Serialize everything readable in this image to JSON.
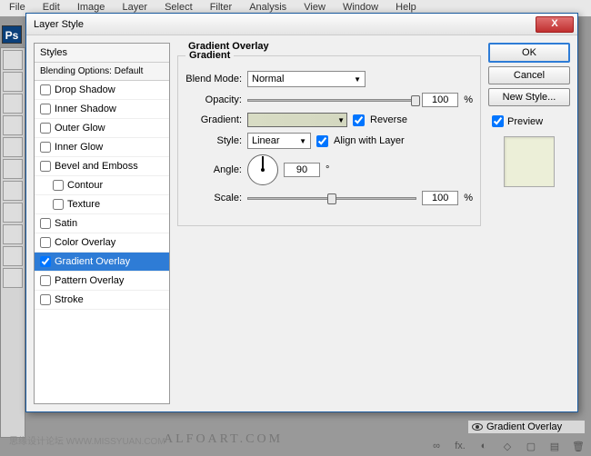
{
  "menubar": [
    "File",
    "Edit",
    "Image",
    "Layer",
    "Select",
    "Filter",
    "Analysis",
    "View",
    "Window",
    "Help"
  ],
  "dialog": {
    "title": "Layer Style",
    "close": "X"
  },
  "styles": {
    "header": "Styles",
    "blending": "Blending Options: Default",
    "items": [
      {
        "label": "Drop Shadow",
        "checked": false,
        "indent": false,
        "selected": false
      },
      {
        "label": "Inner Shadow",
        "checked": false,
        "indent": false,
        "selected": false
      },
      {
        "label": "Outer Glow",
        "checked": false,
        "indent": false,
        "selected": false
      },
      {
        "label": "Inner Glow",
        "checked": false,
        "indent": false,
        "selected": false
      },
      {
        "label": "Bevel and Emboss",
        "checked": false,
        "indent": false,
        "selected": false
      },
      {
        "label": "Contour",
        "checked": false,
        "indent": true,
        "selected": false
      },
      {
        "label": "Texture",
        "checked": false,
        "indent": true,
        "selected": false
      },
      {
        "label": "Satin",
        "checked": false,
        "indent": false,
        "selected": false
      },
      {
        "label": "Color Overlay",
        "checked": false,
        "indent": false,
        "selected": false
      },
      {
        "label": "Gradient Overlay",
        "checked": true,
        "indent": false,
        "selected": true
      },
      {
        "label": "Pattern Overlay",
        "checked": false,
        "indent": false,
        "selected": false
      },
      {
        "label": "Stroke",
        "checked": false,
        "indent": false,
        "selected": false
      }
    ]
  },
  "gradient_overlay": {
    "title": "Gradient Overlay",
    "group": "Gradient",
    "blend_mode_label": "Blend Mode:",
    "blend_mode": "Normal",
    "opacity_label": "Opacity:",
    "opacity": "100",
    "opacity_unit": "%",
    "gradient_label": "Gradient:",
    "reverse_label": "Reverse",
    "reverse_checked": true,
    "style_label": "Style:",
    "style": "Linear",
    "align_label": "Align with Layer",
    "align_checked": true,
    "angle_label": "Angle:",
    "angle": "90",
    "angle_unit": "°",
    "scale_label": "Scale:",
    "scale": "100",
    "scale_unit": "%"
  },
  "buttons": {
    "ok": "OK",
    "cancel": "Cancel",
    "new_style": "New Style...",
    "preview": "Preview"
  },
  "bottom": {
    "layer_effect": "Gradient Overlay",
    "icons": [
      "∞",
      "fx.",
      "◐",
      "◇",
      "▢",
      "▤",
      "🗑"
    ]
  },
  "watermark1": "思缘设计论坛  WWW.MISSYUAN.COM",
  "watermark2": "ALFOART.COM",
  "ps_label": "Ps"
}
